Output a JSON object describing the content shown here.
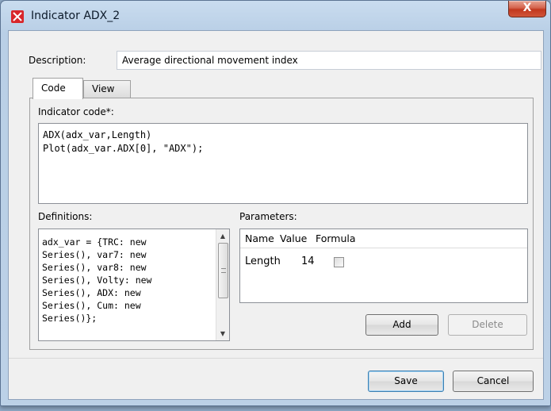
{
  "window": {
    "title": "Indicator ADX_2",
    "close_label": "X"
  },
  "description": {
    "label": "Description:",
    "value": "Average directional movement index"
  },
  "tabs": [
    {
      "label": "Code",
      "active": true
    },
    {
      "label": "View",
      "active": false
    }
  ],
  "code": {
    "label": "Indicator code*:",
    "text": "ADX(adx_var,Length)\nPlot(adx_var.ADX[0], \"ADX\");"
  },
  "definitions": {
    "label": "Definitions:",
    "text": "adx_var = {TRC: new\nSeries(), var7: new\nSeries(), var8: new\nSeries(), Volty: new\nSeries(), ADX: new\nSeries(), Cum: new\nSeries()};"
  },
  "parameters": {
    "label": "Parameters:",
    "columns": [
      "Name",
      "Value",
      "Formula"
    ],
    "rows": [
      {
        "name": "Length",
        "value": "14",
        "formula": false
      }
    ],
    "add_label": "Add",
    "delete_label": "Delete"
  },
  "footer": {
    "save_label": "Save",
    "cancel_label": "Cancel"
  },
  "colors": {
    "app_icon": "#d8262a",
    "close_button": "#c2381e",
    "default_button_border": "#3c7fb1"
  }
}
